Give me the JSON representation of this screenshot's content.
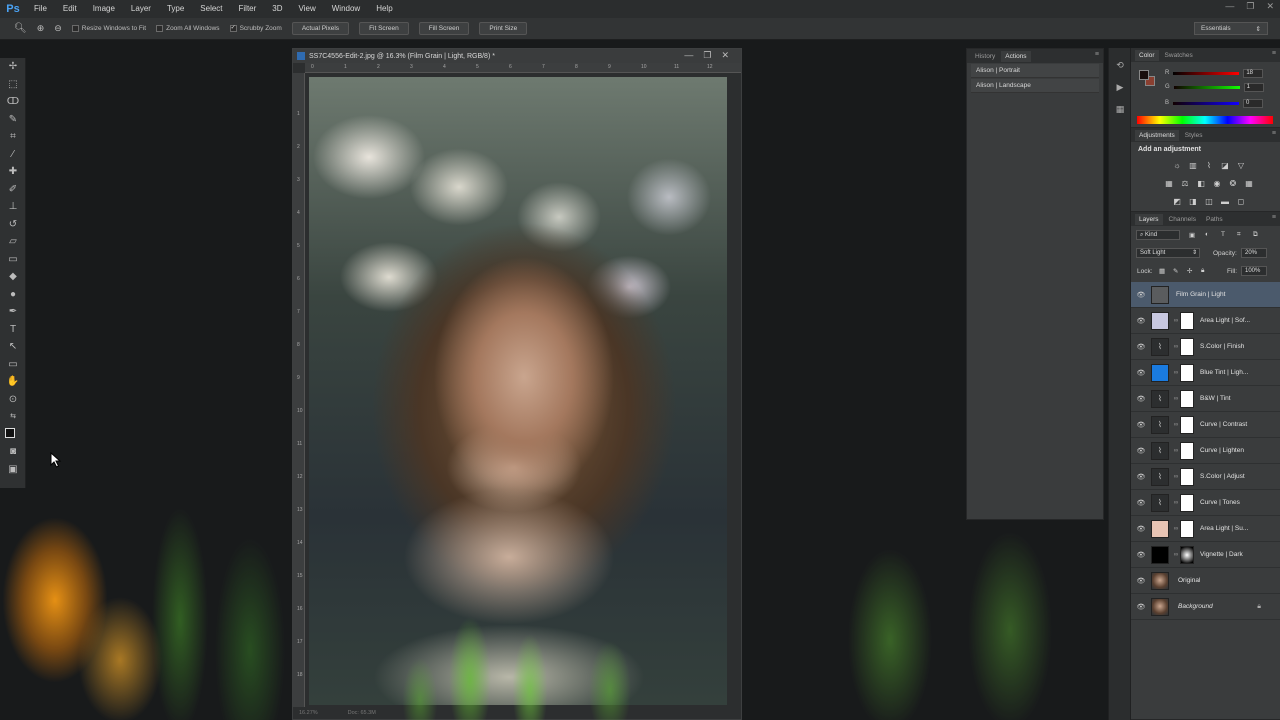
{
  "app": {
    "logo": "Ps"
  },
  "menu": [
    "File",
    "Edit",
    "Image",
    "Layer",
    "Type",
    "Select",
    "Filter",
    "3D",
    "View",
    "Window",
    "Help"
  ],
  "window_controls": [
    "—",
    "❐",
    "✕"
  ],
  "options": {
    "resize_windows": "Resize Windows to Fit",
    "zoom_all": "Zoom All Windows",
    "scrubby_zoom": "Scrubby Zoom",
    "actual_pixels": "Actual Pixels",
    "fit_screen": "Fit Screen",
    "fill_screen": "Fill Screen",
    "print_size": "Print Size",
    "workspace": "Essentials"
  },
  "document": {
    "title": "SS7C4556-Edit-2.jpg @ 16.3% (Film Grain | Light, RGB/8) *",
    "zoom_readout": "16.27%",
    "doc_size": "Doc: 65.3M",
    "ruler_h": [
      "0",
      "1",
      "2",
      "3",
      "4",
      "5",
      "6",
      "7",
      "8",
      "9",
      "10",
      "11",
      "12"
    ],
    "ruler_v": [
      "1",
      "2",
      "3",
      "4",
      "5",
      "6",
      "7",
      "8",
      "9",
      "10",
      "11",
      "12",
      "13",
      "14",
      "15",
      "16",
      "17",
      "18"
    ]
  },
  "history_panel": {
    "tabs": [
      "History",
      "Actions"
    ],
    "active_tab": "Actions",
    "actions": [
      "Alison | Portrait",
      "Alison | Landscape"
    ]
  },
  "color_panel": {
    "tabs": [
      "Color",
      "Swatches"
    ],
    "foreground": "#1a0f0d",
    "background": "#8a3f30",
    "r_label": "R",
    "g_label": "G",
    "b_label": "B",
    "r": "18",
    "g": "1",
    "b": "0"
  },
  "adjustments_panel": {
    "tabs": [
      "Adjustments",
      "Styles"
    ],
    "title": "Add an adjustment"
  },
  "layers_panel": {
    "tabs": [
      "Layers",
      "Channels",
      "Paths"
    ],
    "filter_kind": "Kind",
    "blend_mode": "Soft Light",
    "opacity_label": "Opacity:",
    "opacity": "20%",
    "lock_label": "Lock:",
    "fill_label": "Fill:",
    "fill": "100%",
    "layers": [
      {
        "name": "Film Grain | Light",
        "thumb": "#5a5c5e",
        "mask": false,
        "selected": true
      },
      {
        "name": "Area Light | Sof...",
        "thumb": "#c8c8e0",
        "mask": true
      },
      {
        "name": "S.Color | Finish",
        "thumb": "adj",
        "mask": true
      },
      {
        "name": "Blue Tint | Ligh...",
        "thumb": "#1a7be0",
        "mask": true
      },
      {
        "name": "B&W | Tint",
        "thumb": "adj",
        "mask": true
      },
      {
        "name": "Curve | Contrast",
        "thumb": "adj",
        "mask": true
      },
      {
        "name": "Curve | Lighten",
        "thumb": "adj",
        "mask": true
      },
      {
        "name": "S.Color | Adjust",
        "thumb": "adj",
        "mask": true
      },
      {
        "name": "Curve | Tones",
        "thumb": "adj",
        "mask": true
      },
      {
        "name": "Area Light | Su...",
        "thumb": "#e8c4b4",
        "mask": true
      },
      {
        "name": "Vignette | Dark",
        "thumb": "#000000",
        "mask": true
      },
      {
        "name": "Original",
        "thumb": "photo",
        "mask": false
      },
      {
        "name": "Background",
        "thumb": "photo",
        "mask": false,
        "italic": true,
        "locked": true
      }
    ]
  }
}
